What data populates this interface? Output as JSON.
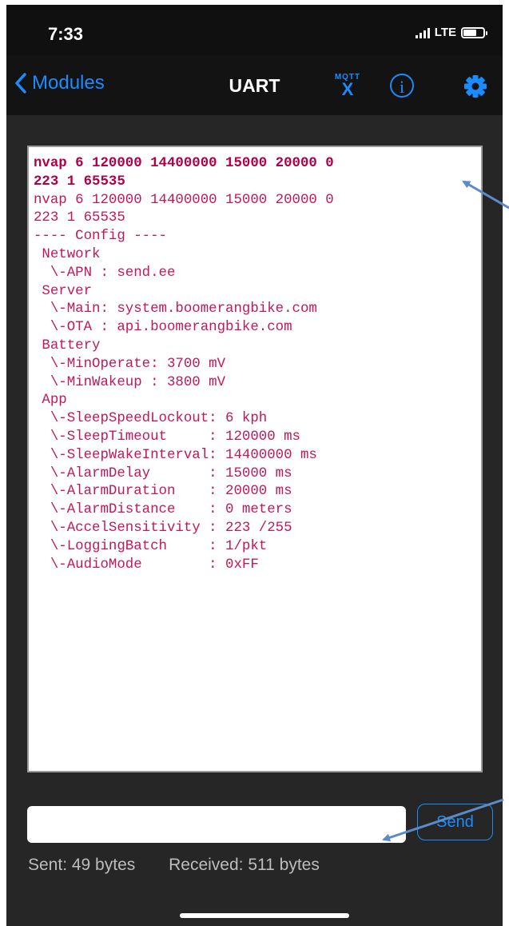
{
  "statusbar": {
    "time": "7:33",
    "network": "LTE"
  },
  "navbar": {
    "back_label": "Modules",
    "title": "UART",
    "mqtt_top": "MQTT",
    "mqtt_bottom": "X",
    "info_glyph": "i"
  },
  "console": {
    "bold_lines": "nvap 6 120000 14400000 15000 20000 0\n223 1 65535",
    "lines": "nvap 6 120000 14400000 15000 20000 0\n223 1 65535\n---- Config ----\n Network\n  \\-APN : send.ee\n Server\n  \\-Main: system.boomerangbike.com\n  \\-OTA : api.boomerangbike.com\n Battery\n  \\-MinOperate: 3700 mV\n  \\-MinWakeup : 3800 mV\n App\n  \\-SleepSpeedLockout: 6 kph\n  \\-SleepTimeout     : 120000 ms\n  \\-SleepWakeInterval: 14400000 ms\n  \\-AlarmDelay       : 15000 ms\n  \\-AlarmDuration    : 20000 ms\n  \\-AlarmDistance    : 0 meters\n  \\-AccelSensitivity : 223 /255\n  \\-LoggingBatch     : 1/pkt\n  \\-AudioMode        : 0xFF"
  },
  "input": {
    "value": "",
    "placeholder": ""
  },
  "send_label": "Send",
  "stats": {
    "sent": "Sent: 49 bytes",
    "received": "Received: 511 bytes"
  },
  "colors": {
    "accent": "#1a8cff",
    "console_text": "#c2185b",
    "arrow": "#5b8bc9"
  }
}
